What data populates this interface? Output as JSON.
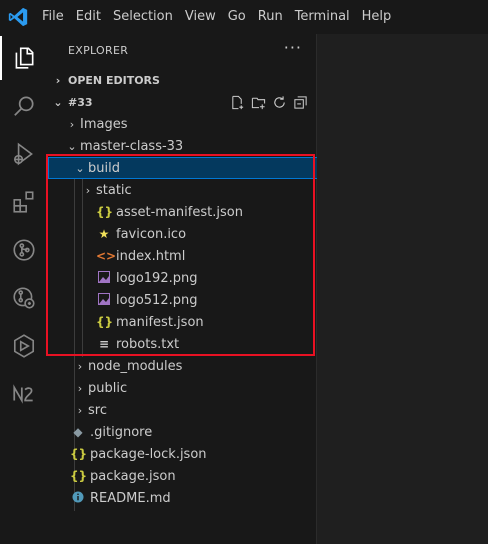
{
  "menu": [
    "File",
    "Edit",
    "Selection",
    "View",
    "Go",
    "Run",
    "Terminal",
    "Help"
  ],
  "activity_bar": [
    "files-icon",
    "search-icon",
    "run-debug-icon",
    "extensions-icon",
    "source-control-icon",
    "remote-explorer-icon",
    "deploy-icon",
    "nx-console-icon"
  ],
  "explorer": {
    "title": "EXPLORER",
    "more": "···",
    "open_editors": "OPEN EDITORS",
    "project": "#33",
    "project_actions": [
      "new-file-icon",
      "new-folder-icon",
      "refresh-icon",
      "collapse-all-icon"
    ]
  },
  "tree": [
    {
      "label": "Images",
      "kind": "folder",
      "expanded": false
    },
    {
      "label": "master-class-33",
      "kind": "folder",
      "expanded": true
    },
    {
      "label": "build",
      "kind": "folder",
      "expanded": true,
      "selected": true
    },
    {
      "label": "static",
      "kind": "folder",
      "expanded": false
    },
    {
      "label": "asset-manifest.json",
      "kind": "json"
    },
    {
      "label": "favicon.ico",
      "kind": "ico"
    },
    {
      "label": "index.html",
      "kind": "html"
    },
    {
      "label": "logo192.png",
      "kind": "image"
    },
    {
      "label": "logo512.png",
      "kind": "image"
    },
    {
      "label": "manifest.json",
      "kind": "json"
    },
    {
      "label": "robots.txt",
      "kind": "text"
    },
    {
      "label": "node_modules",
      "kind": "folder",
      "expanded": false
    },
    {
      "label": "public",
      "kind": "folder",
      "expanded": false
    },
    {
      "label": "src",
      "kind": "folder",
      "expanded": false
    },
    {
      "label": ".gitignore",
      "kind": "git"
    },
    {
      "label": "package-lock.json",
      "kind": "json"
    },
    {
      "label": "package.json",
      "kind": "json"
    },
    {
      "label": "README.md",
      "kind": "info"
    }
  ],
  "colors": {
    "json": "#cbcb41",
    "ico": "#f1e05a",
    "html": "#e37933",
    "image": "#a074c4",
    "text": "#cccccc",
    "git": "#41535b",
    "info": "#519aba",
    "highlight": "#e81123",
    "selection": "#04395e",
    "accent": "#0078d4"
  }
}
